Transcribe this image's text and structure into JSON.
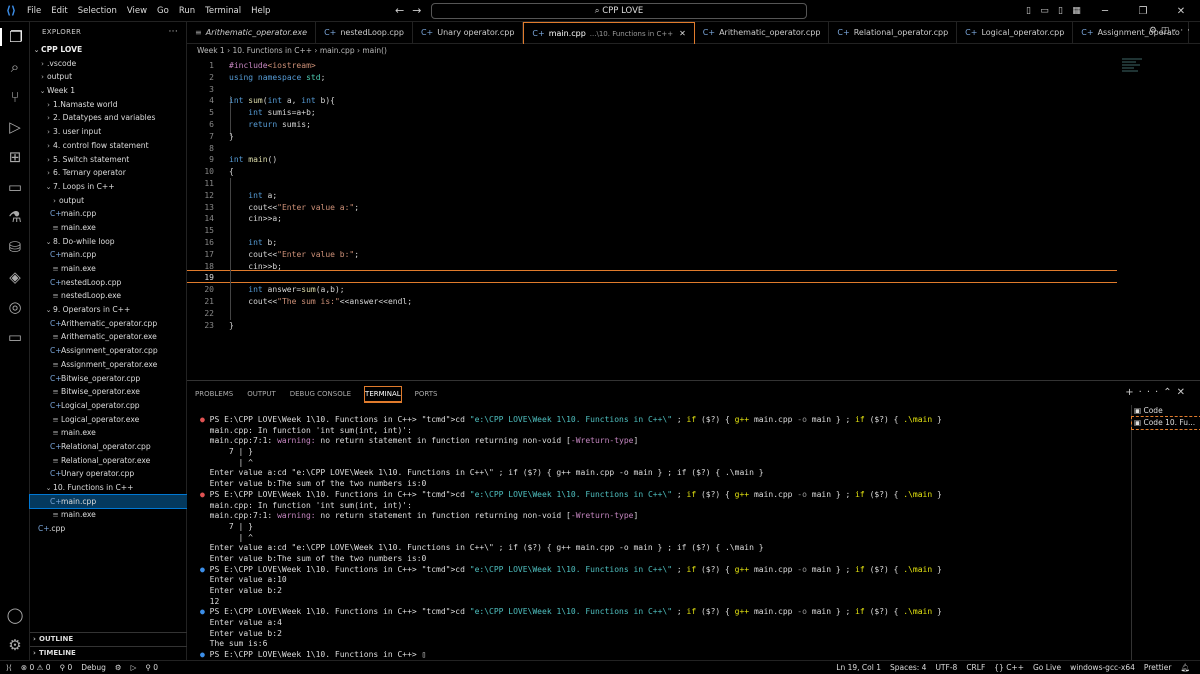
{
  "menu": [
    "File",
    "Edit",
    "Selection",
    "View",
    "Go",
    "Run",
    "Terminal",
    "Help"
  ],
  "command_center": "CPP LOVE",
  "explorer": {
    "title": "EXPLORER",
    "root": "CPP LOVE",
    "items": [
      {
        "label": ".vscode",
        "depth": 1,
        "type": "folder",
        "open": false
      },
      {
        "label": "output",
        "depth": 1,
        "type": "folder",
        "open": false
      },
      {
        "label": "Week 1",
        "depth": 1,
        "type": "folder",
        "open": true
      },
      {
        "label": "1.Namaste world",
        "depth": 2,
        "type": "folder",
        "open": false
      },
      {
        "label": "2. Datatypes and variables",
        "depth": 2,
        "type": "folder",
        "open": false
      },
      {
        "label": "3. user input",
        "depth": 2,
        "type": "folder",
        "open": false
      },
      {
        "label": "4. control flow statement",
        "depth": 2,
        "type": "folder",
        "open": false
      },
      {
        "label": "5. Switch statement",
        "depth": 2,
        "type": "folder",
        "open": false
      },
      {
        "label": "6. Ternary operator",
        "depth": 2,
        "type": "folder",
        "open": false
      },
      {
        "label": "7. Loops in C++",
        "depth": 2,
        "type": "folder",
        "open": true
      },
      {
        "label": "output",
        "depth": 3,
        "type": "folder",
        "open": false
      },
      {
        "label": "main.cpp",
        "depth": 3,
        "type": "cpp"
      },
      {
        "label": "main.exe",
        "depth": 3,
        "type": "exe"
      },
      {
        "label": "8. Do-while loop",
        "depth": 2,
        "type": "folder",
        "open": true
      },
      {
        "label": "main.cpp",
        "depth": 3,
        "type": "cpp"
      },
      {
        "label": "main.exe",
        "depth": 3,
        "type": "exe"
      },
      {
        "label": "nestedLoop.cpp",
        "depth": 3,
        "type": "cpp"
      },
      {
        "label": "nestedLoop.exe",
        "depth": 3,
        "type": "exe"
      },
      {
        "label": "9. Operators in C++",
        "depth": 2,
        "type": "folder",
        "open": true
      },
      {
        "label": "Arithematic_operator.cpp",
        "depth": 3,
        "type": "cpp"
      },
      {
        "label": "Arithematic_operator.exe",
        "depth": 3,
        "type": "exe"
      },
      {
        "label": "Assignment_operator.cpp",
        "depth": 3,
        "type": "cpp"
      },
      {
        "label": "Assignment_operator.exe",
        "depth": 3,
        "type": "exe"
      },
      {
        "label": "Bitwise_operator.cpp",
        "depth": 3,
        "type": "cpp"
      },
      {
        "label": "Bitwise_operator.exe",
        "depth": 3,
        "type": "exe"
      },
      {
        "label": "Logical_operator.cpp",
        "depth": 3,
        "type": "cpp"
      },
      {
        "label": "Logical_operator.exe",
        "depth": 3,
        "type": "exe"
      },
      {
        "label": "main.exe",
        "depth": 3,
        "type": "exe"
      },
      {
        "label": "Relational_operator.cpp",
        "depth": 3,
        "type": "cpp"
      },
      {
        "label": "Relational_operator.exe",
        "depth": 3,
        "type": "exe"
      },
      {
        "label": "Unary operator.cpp",
        "depth": 3,
        "type": "cpp"
      },
      {
        "label": "10. Functions in C++",
        "depth": 2,
        "type": "folder",
        "open": true
      },
      {
        "label": "main.cpp",
        "depth": 3,
        "type": "cpp",
        "selected": true
      },
      {
        "label": "main.exe",
        "depth": 3,
        "type": "exe"
      },
      {
        "label": ".cpp",
        "depth": 1,
        "type": "cpp"
      }
    ],
    "outline": "OUTLINE",
    "timeline": "TIMELINE"
  },
  "tabs": [
    {
      "label": "Arithematic_operator.exe",
      "type": "exe",
      "italic": true
    },
    {
      "label": "nestedLoop.cpp",
      "type": "cpp"
    },
    {
      "label": "Unary operator.cpp",
      "type": "cpp"
    },
    {
      "label": "main.cpp",
      "type": "cpp",
      "active": true,
      "desc": "...\\10. Functions in C++"
    },
    {
      "label": "Arithematic_operator.cpp",
      "type": "cpp"
    },
    {
      "label": "Relational_operator.cpp",
      "type": "cpp"
    },
    {
      "label": "Logical_operator.cpp",
      "type": "cpp"
    },
    {
      "label": "Assignment_operato",
      "type": "cpp"
    }
  ],
  "breadcrumb": [
    "Week 1",
    "10. Functions in C++",
    "main.cpp",
    "main()"
  ],
  "code_lines": [
    "#include<iostream>",
    "using namespace std;",
    "",
    "int sum(int a, int b){",
    "    int sumis=a+b;",
    "    return sumis;",
    "}",
    "",
    "int main()",
    "{",
    "",
    "    int a;",
    "    cout<<\"Enter value a:\";",
    "    cin>>a;",
    "",
    "    int b;",
    "    cout<<\"Enter value b:\";",
    "    cin>>b;",
    "",
    "    int answer=sum(a,b);",
    "    cout<<\"The sum is:\"<<answer<<endl;",
    "",
    "}"
  ],
  "current_line": 19,
  "panel_tabs": [
    "PROBLEMS",
    "OUTPUT",
    "DEBUG CONSOLE",
    "TERMINAL",
    "PORTS"
  ],
  "active_panel_tab": "TERMINAL",
  "terminal_lines": [
    "PS E:\\CPP LOVE\\Week 1\\10. Functions in C++> cd \"e:\\CPP LOVE\\Week 1\\10. Functions in C++\\\" ; if ($?) { g++ main.cpp -o main } ; if ($?) { .\\main }",
    "main.cpp: In function 'int sum(int, int)':",
    "main.cpp:7:1: warning: no return statement in function returning non-void [-Wreturn-type]",
    "    7 | }",
    "      | ^",
    "Enter value a:cd \"e:\\CPP LOVE\\Week 1\\10. Functions in C++\\\" ; if ($?) { g++ main.cpp -o main } ; if ($?) { .\\main }",
    "Enter value b:The sum of the two numbers is:0",
    "PS E:\\CPP LOVE\\Week 1\\10. Functions in C++> cd \"e:\\CPP LOVE\\Week 1\\10. Functions in C++\\\" ; if ($?) { g++ main.cpp -o main } ; if ($?) { .\\main }",
    "main.cpp: In function 'int sum(int, int)':",
    "main.cpp:7:1: warning: no return statement in function returning non-void [-Wreturn-type]",
    "    7 | }",
    "      | ^",
    "Enter value a:cd \"e:\\CPP LOVE\\Week 1\\10. Functions in C++\\\" ; if ($?) { g++ main.cpp -o main } ; if ($?) { .\\main }",
    "Enter value b:The sum of the two numbers is:0",
    "PS E:\\CPP LOVE\\Week 1\\10. Functions in C++> cd \"e:\\CPP LOVE\\Week 1\\10. Functions in C++\\\" ; if ($?) { g++ main.cpp -o main } ; if ($?) { .\\main }",
    "Enter value a:10",
    "Enter value b:2",
    "12",
    "PS E:\\CPP LOVE\\Week 1\\10. Functions in C++> cd \"e:\\CPP LOVE\\Week 1\\10. Functions in C++\\\" ; if ($?) { g++ main.cpp -o main } ; if ($?) { .\\main }",
    "Enter value a:4",
    "Enter value b:2",
    "The sum is:6",
    "PS E:\\CPP LOVE\\Week 1\\10. Functions in C++> "
  ],
  "terminal_sessions": [
    "Code",
    "Code 10. Fu..."
  ],
  "status": {
    "left": [
      "⊗ 0 ⚠ 0",
      "⚲ 0",
      "Debug",
      "⚙",
      "▷",
      "⚲ 0"
    ],
    "right": [
      "Ln 19, Col 1",
      "Spaces: 4",
      "UTF-8",
      "CRLF",
      "{} C++",
      "Go Live",
      "windows-gcc-x64",
      "Prettier"
    ]
  },
  "colors": {
    "accent": "#e07b2c",
    "selection": "#04395e",
    "keyword": "#569cd6",
    "string": "#ce9178"
  }
}
